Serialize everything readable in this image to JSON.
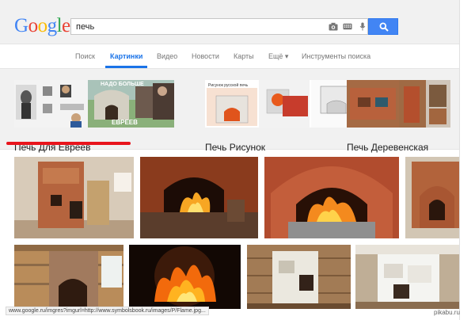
{
  "logo": [
    "G",
    "o",
    "o",
    "g",
    "l",
    "e"
  ],
  "search": {
    "value": "печь"
  },
  "nav": {
    "items": [
      "Поиск",
      "Картинки",
      "Видео",
      "Новости",
      "Карты",
      "Ещё ▾",
      "Инструменты поиска"
    ],
    "active": "Картинки"
  },
  "related": [
    {
      "label": "Печь Для Евреев",
      "overlay_text_1": "НАДО БОЛЬШЕ",
      "overlay_text_2": "ЕВРЕЕВ"
    },
    {
      "label": "Печь Рисунок",
      "image_caption": "Рисунок русской печь"
    },
    {
      "label": "Печь Деревенская"
    }
  ],
  "status_url": "www.google.ru/imgres?imgurl=http://www.symbolsbook.ru/images/P/Flame.jpg...",
  "watermark": "pikabu.ru",
  "colors": {
    "accent": "#1a73e8",
    "search_button": "#4285f4",
    "highlight": "#e8141c"
  },
  "icons": [
    "camera-icon",
    "keyboard-icon",
    "microphone-icon",
    "search-icon"
  ]
}
